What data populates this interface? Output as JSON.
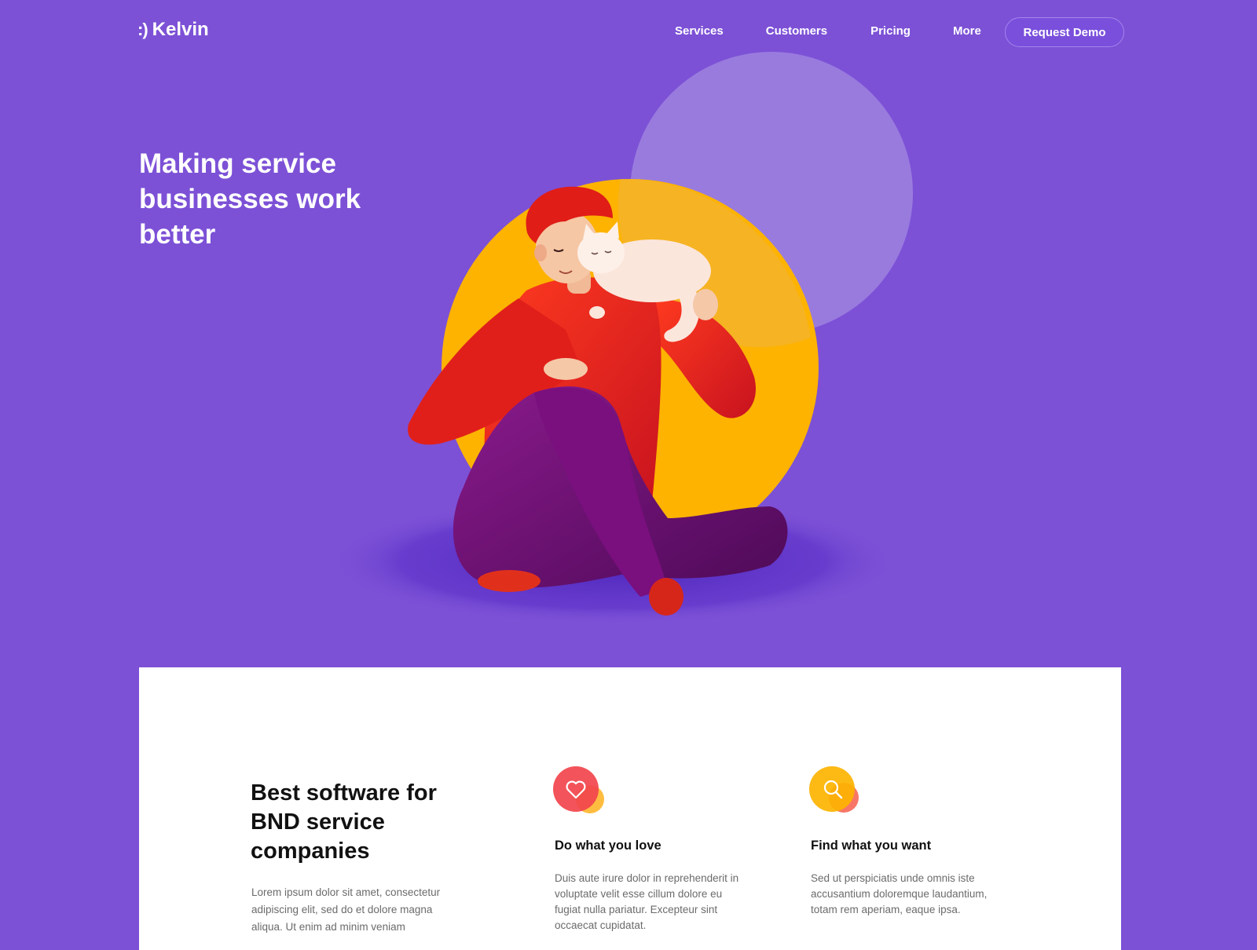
{
  "brand": {
    "mark": ":)",
    "name": "Kelvin"
  },
  "nav": {
    "items": [
      "Services",
      "Customers",
      "Pricing",
      "More"
    ]
  },
  "cta": {
    "request_demo": "Request Demo"
  },
  "hero": {
    "headline": "Making service businesses work better"
  },
  "colors": {
    "background": "#7c51d6",
    "sun": "#fdb300",
    "sweater": "#e8231c",
    "pants": "#74107a",
    "card": "#ffffff"
  },
  "section": {
    "title": "Best software for BND service companies",
    "description": "Lorem ipsum dolor sit amet, consectetur adipiscing elit, sed do et dolore magna aliqua. Ut enim ad minim veniam",
    "features": [
      {
        "icon": "heart-icon",
        "title": "Do what you love",
        "description": "Duis aute irure dolor in reprehenderit in voluptate velit esse cillum dolore eu fugiat nulla pariatur. Excepteur sint occaecat cupidatat."
      },
      {
        "icon": "search-icon",
        "title": "Find what you want",
        "description": "Sed ut perspiciatis unde omnis iste accusantium doloremque laudantium, totam rem aperiam, eaque ipsa."
      }
    ]
  }
}
